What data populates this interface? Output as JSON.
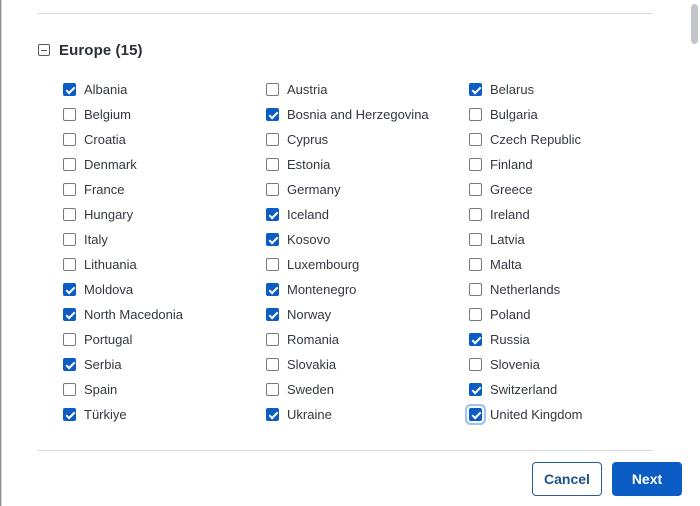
{
  "group": {
    "title": "Europe (15)",
    "countries": [
      {
        "name": "Albania",
        "checked": true
      },
      {
        "name": "Austria",
        "checked": false
      },
      {
        "name": "Belarus",
        "checked": true
      },
      {
        "name": "Belgium",
        "checked": false
      },
      {
        "name": "Bosnia and Herzegovina",
        "checked": true
      },
      {
        "name": "Bulgaria",
        "checked": false
      },
      {
        "name": "Croatia",
        "checked": false
      },
      {
        "name": "Cyprus",
        "checked": false
      },
      {
        "name": "Czech Republic",
        "checked": false
      },
      {
        "name": "Denmark",
        "checked": false
      },
      {
        "name": "Estonia",
        "checked": false
      },
      {
        "name": "Finland",
        "checked": false
      },
      {
        "name": "France",
        "checked": false
      },
      {
        "name": "Germany",
        "checked": false
      },
      {
        "name": "Greece",
        "checked": false
      },
      {
        "name": "Hungary",
        "checked": false
      },
      {
        "name": "Iceland",
        "checked": true
      },
      {
        "name": "Ireland",
        "checked": false
      },
      {
        "name": "Italy",
        "checked": false
      },
      {
        "name": "Kosovo",
        "checked": true
      },
      {
        "name": "Latvia",
        "checked": false
      },
      {
        "name": "Lithuania",
        "checked": false
      },
      {
        "name": "Luxembourg",
        "checked": false
      },
      {
        "name": "Malta",
        "checked": false
      },
      {
        "name": "Moldova",
        "checked": true
      },
      {
        "name": "Montenegro",
        "checked": true
      },
      {
        "name": "Netherlands",
        "checked": false
      },
      {
        "name": "North Macedonia",
        "checked": true
      },
      {
        "name": "Norway",
        "checked": true
      },
      {
        "name": "Poland",
        "checked": false
      },
      {
        "name": "Portugal",
        "checked": false
      },
      {
        "name": "Romania",
        "checked": false
      },
      {
        "name": "Russia",
        "checked": true
      },
      {
        "name": "Serbia",
        "checked": true
      },
      {
        "name": "Slovakia",
        "checked": false
      },
      {
        "name": "Slovenia",
        "checked": false
      },
      {
        "name": "Spain",
        "checked": false
      },
      {
        "name": "Sweden",
        "checked": false
      },
      {
        "name": "Switzerland",
        "checked": true
      },
      {
        "name": "Türkiye",
        "checked": true
      },
      {
        "name": "Ukraine",
        "checked": true
      },
      {
        "name": "United Kingdom",
        "checked": true,
        "focused": true
      }
    ]
  },
  "footer": {
    "cancel_label": "Cancel",
    "next_label": "Next"
  },
  "colors": {
    "accent": "#0b5cc4",
    "focus_ring": "#9fc3ef"
  }
}
